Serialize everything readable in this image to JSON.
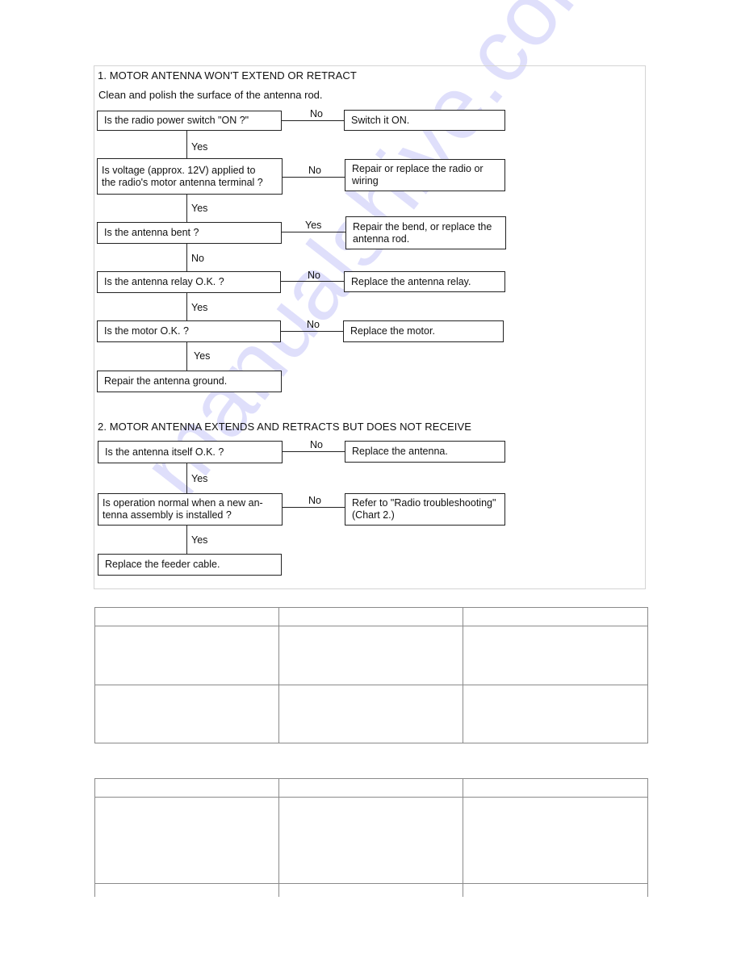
{
  "section1": {
    "title": "1.  MOTOR ANTENNA WON'T EXTEND OR RETRACT",
    "note": "Clean and polish the surface of the antenna rod.",
    "steps": [
      {
        "question": "Is the radio power switch \"ON ?\"",
        "branch_label": "No",
        "action": "Switch it ON.",
        "continue_label": "Yes"
      },
      {
        "question_lines": [
          "Is voltage (approx. 12V) applied to",
          "the radio's motor antenna terminal ?"
        ],
        "branch_label": "No",
        "action_lines": [
          "Repair or replace the radio or",
          "wiring"
        ],
        "continue_label": "Yes"
      },
      {
        "question": "Is the antenna bent ?",
        "branch_label": "Yes",
        "action_lines": [
          "Repair the bend, or replace the",
          "antenna rod."
        ],
        "continue_label": "No"
      },
      {
        "question": "Is the antenna relay O.K. ?",
        "branch_label": "No",
        "action": "Replace the antenna relay.",
        "continue_label": "Yes"
      },
      {
        "question": "Is the motor O.K. ?",
        "branch_label": "No",
        "action": "Replace the motor.",
        "continue_label": "Yes"
      }
    ],
    "final": "Repair the antenna ground."
  },
  "section2": {
    "title": "2.  MOTOR ANTENNA EXTENDS AND RETRACTS BUT DOES NOT RECEIVE",
    "steps": [
      {
        "question": "Is the antenna itself O.K. ?",
        "branch_label": "No",
        "action": "Replace the antenna.",
        "continue_label": "Yes"
      },
      {
        "question_lines": [
          "Is operation normal when a new an-",
          "tenna assembly is installed ?"
        ],
        "branch_label": "No",
        "action_lines": [
          "Refer to \"Radio troubleshooting\"",
          "(Chart 2.)"
        ],
        "continue_label": "Yes"
      }
    ],
    "final": "Replace the feeder cable."
  },
  "tables": [
    {
      "columns": 3,
      "rows": [
        [
          "",
          "",
          ""
        ],
        [
          "",
          "",
          ""
        ],
        [
          "",
          "",
          ""
        ]
      ]
    },
    {
      "columns": 3,
      "rows": [
        [
          "",
          "",
          ""
        ],
        [
          "",
          "",
          ""
        ],
        [
          "",
          "",
          ""
        ]
      ]
    }
  ],
  "watermark": "manualshive.com"
}
